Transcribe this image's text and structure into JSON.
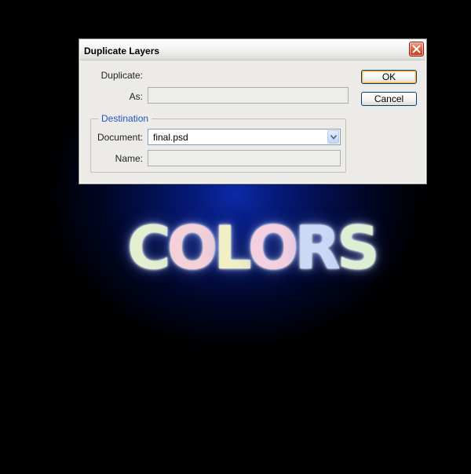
{
  "dialog": {
    "title": "Duplicate Layers",
    "duplicate_label": "Duplicate:",
    "as_label": "As:",
    "as_value": "",
    "destination_legend": "Destination",
    "document_label": "Document:",
    "document_value": "final.psd",
    "name_label": "Name:",
    "name_value": "",
    "ok_label": "OK",
    "cancel_label": "Cancel"
  },
  "canvas": {
    "text_letters": [
      "C",
      "O",
      "L",
      "O",
      "R",
      "S"
    ],
    "letter_colors": [
      "#e3f0cf",
      "#f4d0d8",
      "#f1efc4",
      "#f3cfdf",
      "#c9d9f6",
      "#dcefd2"
    ],
    "background_glow": "#0b2aa6"
  },
  "icons": {
    "close": "close-icon",
    "dropdown": "chevron-down-icon"
  }
}
